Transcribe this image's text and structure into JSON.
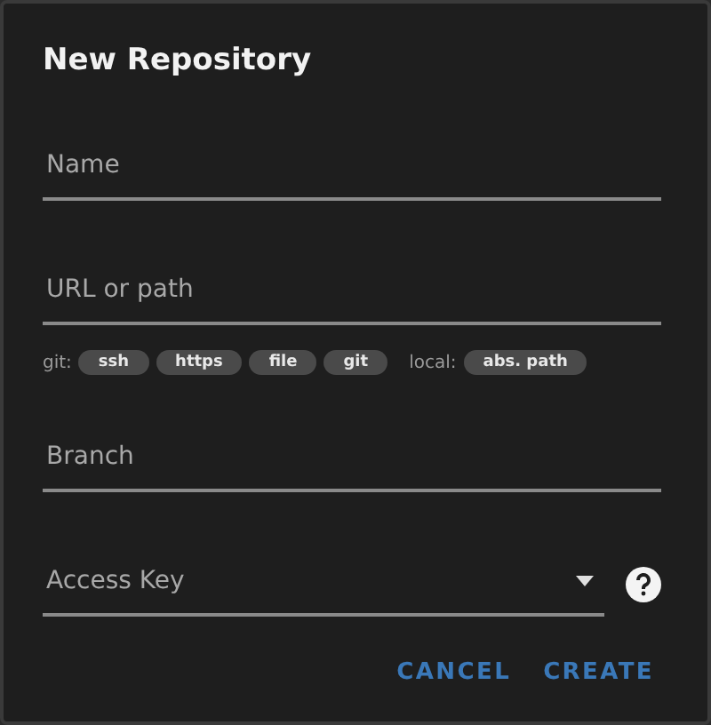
{
  "dialog": {
    "title": "New Repository"
  },
  "fields": [
    {
      "kind": "text",
      "placeholder": "Name"
    },
    {
      "kind": "text",
      "placeholder": "URL or path",
      "hint_groups": [
        {
          "label": "git:",
          "chips": [
            "ssh",
            "https",
            "file",
            "git"
          ]
        },
        {
          "label": "local:",
          "chips": [
            "abs. path"
          ]
        }
      ]
    },
    {
      "kind": "text",
      "placeholder": "Branch"
    },
    {
      "kind": "select",
      "placeholder": "Access Key",
      "help": true
    }
  ],
  "buttons": [
    "CANCEL",
    "CREATE"
  ]
}
